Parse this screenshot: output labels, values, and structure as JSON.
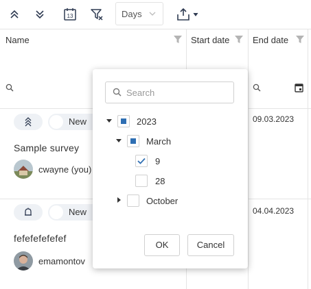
{
  "toolbar": {
    "expand_all_icon": "chevrons-up-icon",
    "collapse_all_icon": "chevrons-down-icon",
    "calendar_icon": "calendar-13-icon",
    "calendar_day": "13",
    "clear_filter_icon": "filter-clear-icon",
    "period_select_value": "Days",
    "export_icon": "share-export-icon"
  },
  "grid": {
    "columns": [
      {
        "label": "Name"
      },
      {
        "label": "Start date"
      },
      {
        "label": "End date"
      }
    ],
    "rows": [
      {
        "priority_icon": "chevrons-up-icon",
        "status": "New",
        "title": "Sample survey",
        "user": "cwayne (you)",
        "end_date": "09.03.2023"
      },
      {
        "priority_icon": "bell-icon",
        "status": "New",
        "title": "fefefefefefef",
        "user": "emamontov",
        "end_date": "04.04.2023"
      }
    ]
  },
  "date_filter_popup": {
    "search_placeholder": "Search",
    "tree": [
      {
        "label": "2023",
        "state": "partial",
        "expanded": true
      },
      {
        "label": "March",
        "state": "partial",
        "expanded": true
      },
      {
        "label": "9",
        "state": "checked"
      },
      {
        "label": "28",
        "state": "unchecked"
      },
      {
        "label": "October",
        "state": "unchecked",
        "expanded": false
      }
    ],
    "ok_label": "OK",
    "cancel_label": "Cancel"
  },
  "colors": {
    "accent": "#2f6fb3",
    "icon": "#2f3b52",
    "pill_bg": "#eef1f5",
    "grid_line": "#e4e4e4"
  }
}
